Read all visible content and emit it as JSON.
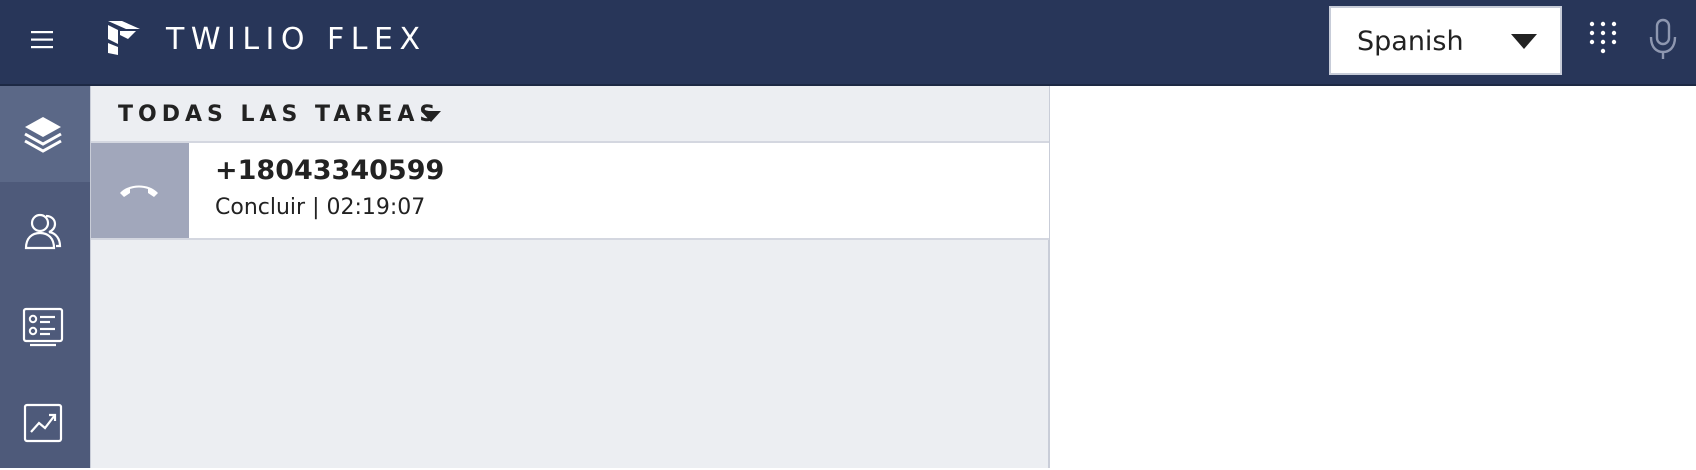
{
  "header": {
    "brand": "TWILIO FLEX",
    "language_select": {
      "value": "Spanish"
    },
    "icons": {
      "menu": "hamburger-menu-icon",
      "logo": "twilio-flex-logo",
      "dialpad": "dialpad-icon",
      "mic": "microphone-icon"
    }
  },
  "sidebar": {
    "items": [
      {
        "icon": "layers-icon",
        "active": true
      },
      {
        "icon": "teams-icon",
        "active": false
      },
      {
        "icon": "queues-stats-icon",
        "active": false
      },
      {
        "icon": "insights-chart-icon",
        "active": false
      }
    ]
  },
  "tasks": {
    "filter_label": "TODAS LAS TAREAS",
    "items": [
      {
        "title": "+18043340599",
        "subtitle": "Concluir | 02:19:07",
        "icon": "phone-hangup-icon"
      }
    ]
  },
  "colors": {
    "header_bg": "#283659",
    "sidebar_bg": "#4e5a7a",
    "panel_bg": "#eceef2",
    "task_icon_bg": "#a1a7bb"
  }
}
